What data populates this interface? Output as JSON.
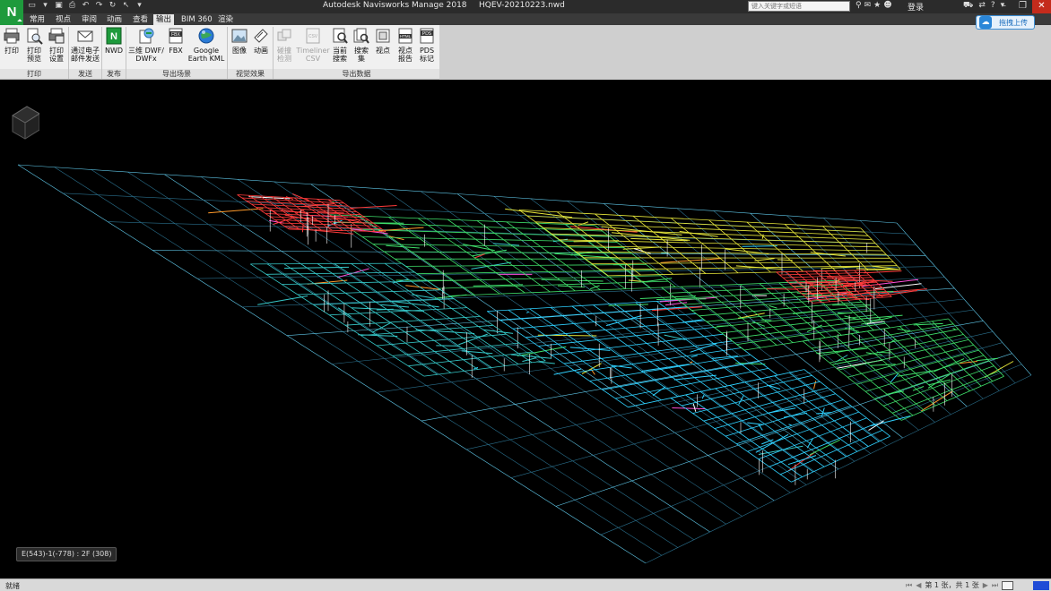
{
  "window": {
    "app_title": "Autodesk Navisworks Manage 2018",
    "file_name": "HQEV-20210223.nwd",
    "logo_letter": "N",
    "search_placeholder": "键入关键字或短语",
    "login_label": "登录",
    "help_label": "?"
  },
  "tabs": [
    {
      "label": "常用",
      "active": false
    },
    {
      "label": "视点",
      "active": false
    },
    {
      "label": "审阅",
      "active": false
    },
    {
      "label": "动画",
      "active": false
    },
    {
      "label": "查看",
      "active": false
    },
    {
      "label": "输出",
      "active": true
    },
    {
      "label": "BIM 360",
      "active": false
    },
    {
      "label": "渲染",
      "active": false
    }
  ],
  "ribbon": {
    "buttons": [
      {
        "label1": "打印",
        "label2": "",
        "icon": "printer-icon",
        "enabled": true
      },
      {
        "label1": "打印",
        "label2": "预览",
        "icon": "print-preview-icon",
        "enabled": true
      },
      {
        "label1": "打印",
        "label2": "设置",
        "icon": "print-setup-icon",
        "enabled": true
      },
      {
        "label1": "通过电子",
        "label2": "邮件发送",
        "icon": "email-icon",
        "enabled": true
      },
      {
        "label1": "NWD",
        "label2": "",
        "icon": "nwd-icon",
        "enabled": true
      },
      {
        "label1": "三维 DWF/",
        "label2": "DWFx",
        "icon": "dwf-icon",
        "enabled": true
      },
      {
        "label1": "FBX",
        "label2": "",
        "icon": "fbx-icon",
        "enabled": true
      },
      {
        "label1": "Google",
        "label2": "Earth KML",
        "icon": "google-earth-icon",
        "enabled": true
      },
      {
        "label1": "图像",
        "label2": "",
        "icon": "image-icon",
        "enabled": true
      },
      {
        "label1": "动画",
        "label2": "",
        "icon": "animation-icon",
        "enabled": true
      },
      {
        "label1": "碰撞",
        "label2": "检测",
        "icon": "clash-icon",
        "enabled": false
      },
      {
        "label1": "Timeliner",
        "label2": "CSV",
        "icon": "timeliner-csv-icon",
        "enabled": false
      },
      {
        "label1": "当前",
        "label2": "搜索",
        "icon": "current-search-icon",
        "enabled": true
      },
      {
        "label1": "搜索",
        "label2": "集",
        "icon": "search-set-icon",
        "enabled": true
      },
      {
        "label1": "视点",
        "label2": "",
        "icon": "viewpoint-icon",
        "enabled": true
      },
      {
        "label1": "视点",
        "label2": "报告",
        "icon": "viewpoint-report-icon",
        "enabled": true
      },
      {
        "label1": "PDS",
        "label2": "标记",
        "icon": "pds-icon",
        "enabled": true
      }
    ],
    "panels": [
      "打印",
      "发送",
      "发布",
      "导出场景",
      "视觉效果",
      "导出数据"
    ]
  },
  "upload_button": "拖拽上传",
  "viewport": {
    "coordinate_readout": "E(543)-1(-778) : 2F (308)"
  },
  "statusbar": {
    "status": "就绪",
    "page_info": "第 1 张，共 1 张"
  }
}
